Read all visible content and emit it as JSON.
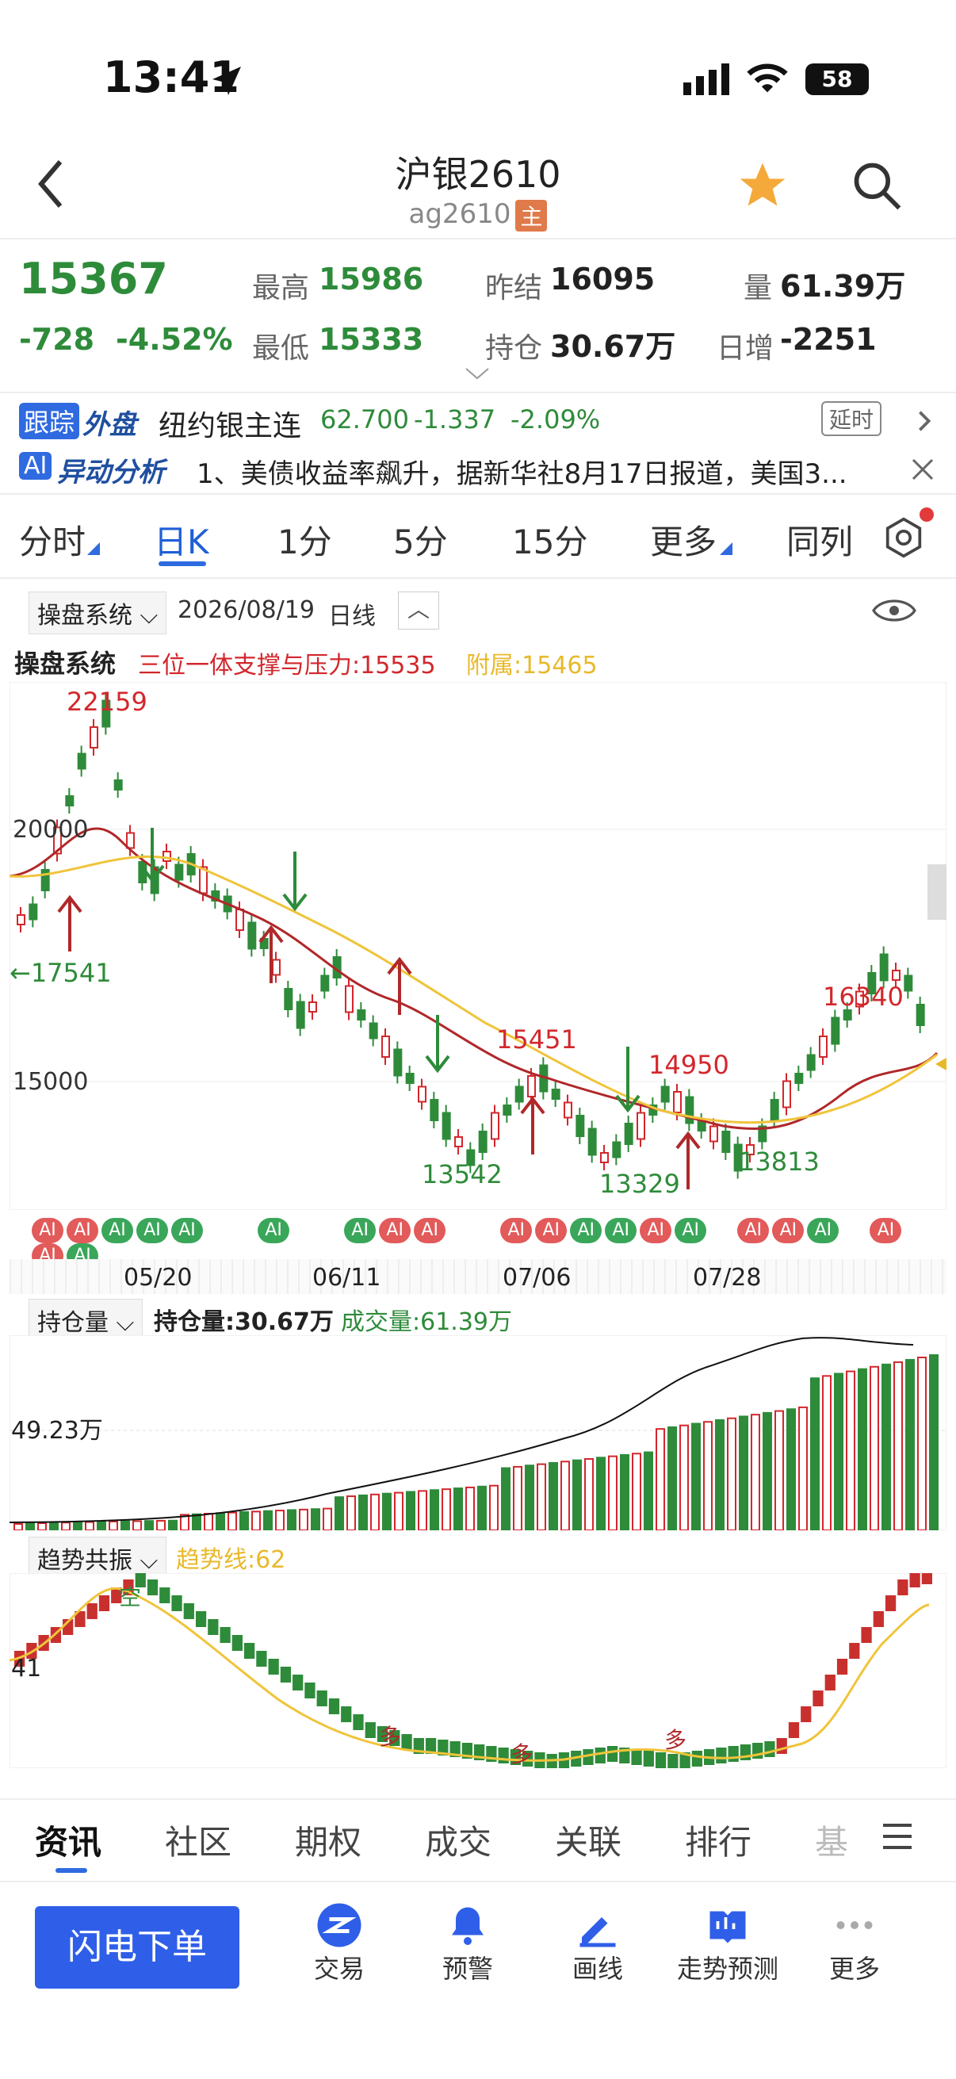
{
  "status": {
    "time": "13:41",
    "battery": "58"
  },
  "nav": {
    "title": "沪银2610",
    "code": "ag2610",
    "badge": "主"
  },
  "quote": {
    "price": "15367",
    "change": "-728",
    "change_pct": "-4.52%",
    "high_label": "最高",
    "high": "15986",
    "low_label": "最低",
    "low": "15333",
    "prev_label": "昨结",
    "prev": "16095",
    "oi_label": "持仓",
    "oi": "30.67万",
    "vol_label": "量",
    "vol": "61.39万",
    "day_inc_label": "日增",
    "day_inc": "-2251"
  },
  "ticker": {
    "tag1": "跟踪",
    "tag2": "外盘",
    "name": "纽约银主连",
    "price": "62.700",
    "chg": "-1.337",
    "pct": "-2.09%",
    "delay": "延时"
  },
  "ai_news": {
    "tag1": "AI",
    "tag2": "异动分析",
    "text": "1、美债收益率飙升，据新华社8月17日报道，美国3..."
  },
  "period_tabs": [
    "分时",
    "日K",
    "1分",
    "5分",
    "15分",
    "更多",
    "同列"
  ],
  "chart_toolbar": {
    "system": "操盘系统",
    "date": "2026/08/19",
    "period": "日线"
  },
  "indicator": {
    "name": "操盘系统",
    "line1": "三位一体支撑与压力:15535",
    "line2": "附属:15465"
  },
  "kline_labels": {
    "y_20000": "20000",
    "y_15000": "15000",
    "hi_22159": "22159",
    "lo_17541": "←17541",
    "lo_13542": "13542",
    "mid_15451": "15451",
    "hi_14950": "14950",
    "lo_13329": "13329",
    "lo_13813": "13813",
    "hi_16340": "16340"
  },
  "x_dates": [
    "05/20",
    "06/11",
    "07/06",
    "07/28"
  ],
  "ai_marker": "AI",
  "oi_panel": {
    "name": "持仓量",
    "oi": "持仓量:30.67万",
    "vol": "成交量:61.39万",
    "y_label": "49.23万"
  },
  "trend_panel": {
    "name": "趋势共振",
    "line": "趋势线:62",
    "y_label": "41",
    "tag_kong": "空",
    "tag_duo": "多"
  },
  "bottom_tabs": [
    "资讯",
    "社区",
    "期权",
    "成交",
    "关联",
    "排行",
    "基"
  ],
  "dock": {
    "order": "闪电下单",
    "items": [
      "交易",
      "预警",
      "画线",
      "走势预测",
      "更多"
    ]
  },
  "chart_data": {
    "type": "candlestick",
    "x": [
      "05/20",
      "06/11",
      "07/06",
      "07/28"
    ],
    "ylim": [
      13000,
      22500
    ],
    "annotated_points": [
      {
        "label": "22159",
        "value": 22159
      },
      {
        "label": "17541",
        "value": 17541
      },
      {
        "label": "13542",
        "value": 13542
      },
      {
        "label": "15451",
        "value": 15451
      },
      {
        "label": "14950",
        "value": 14950
      },
      {
        "label": "13329",
        "value": 13329
      },
      {
        "label": "13813",
        "value": 13813
      },
      {
        "label": "16340",
        "value": 16340
      }
    ]
  }
}
